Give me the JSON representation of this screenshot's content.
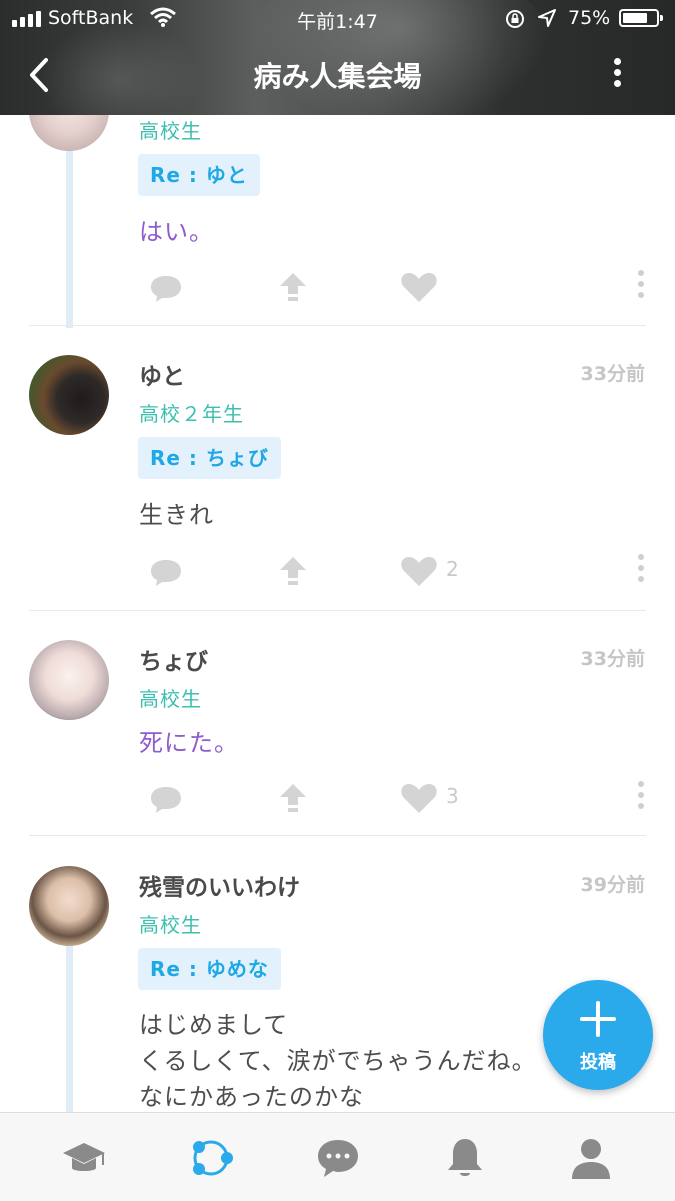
{
  "status_bar": {
    "carrier": "SoftBank",
    "time": "午前1:47",
    "battery": "75%"
  },
  "header": {
    "title": "病み人集会場"
  },
  "posts": [
    {
      "grade": "高校生",
      "reply_to": "Re : ゆと",
      "body": "はい。",
      "likes": ""
    },
    {
      "name": "ゆと",
      "time": "33分前",
      "grade": "高校２年生",
      "reply_to": "Re : ちょび",
      "body": "生きれ",
      "likes": "2"
    },
    {
      "name": "ちょび",
      "time": "33分前",
      "grade": "高校生",
      "body": "死にた。",
      "likes": "3"
    },
    {
      "name": "残雪のいいわけ",
      "time": "39分前",
      "grade": "高校生",
      "reply_to": "Re : ゆめな",
      "body_lines": [
        "はじめまして",
        "くるしくて、涙がでちゃうんだね。",
        "なにかあったのかな"
      ]
    }
  ],
  "fab": {
    "label": "投稿"
  },
  "tabs": [
    "graduation-cap-icon",
    "circle-share-icon",
    "chat-bubble-icon",
    "bell-icon",
    "person-icon"
  ],
  "colors": {
    "accent": "#2aa9eb",
    "grade": "#3dbfae",
    "purple_text": "#8f5ccf",
    "reply_bg": "#e2f1fb"
  }
}
